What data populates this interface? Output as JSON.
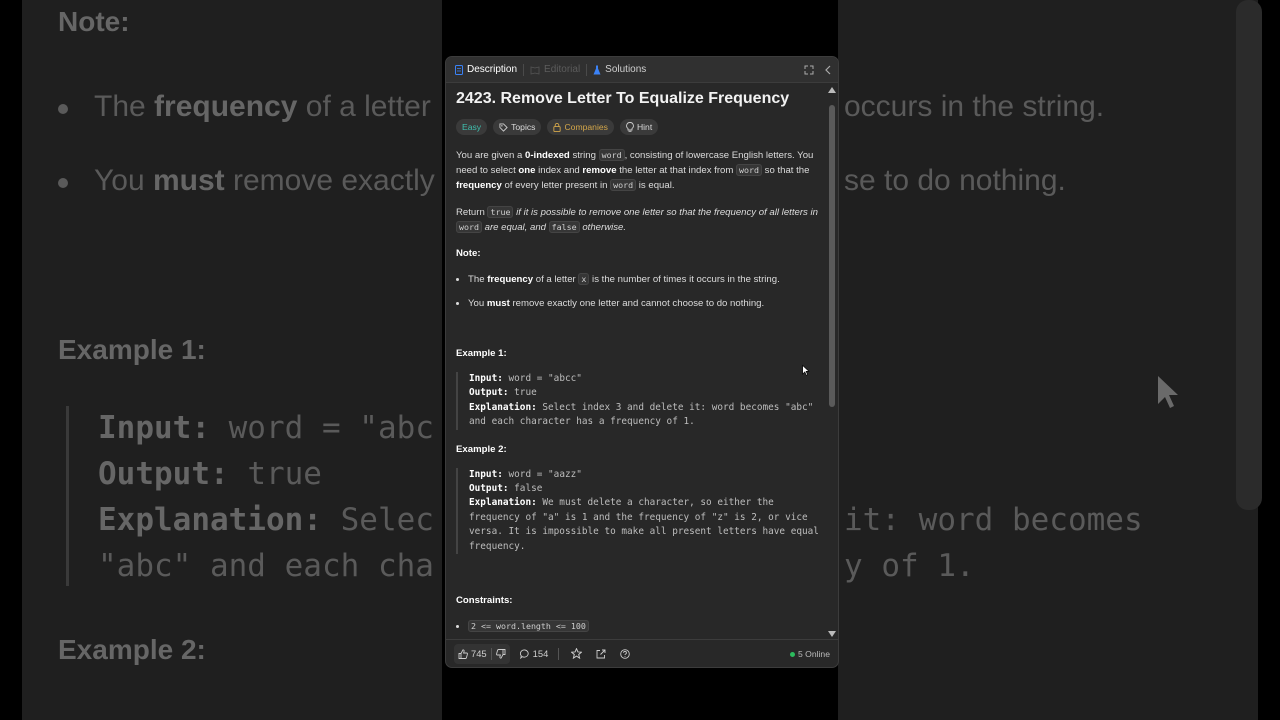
{
  "tabs": [
    {
      "label": "Description",
      "state": "active"
    },
    {
      "label": "Editorial",
      "state": "disabled"
    },
    {
      "label": "Solutions",
      "state": "normal"
    }
  ],
  "problem": {
    "title": "2423. Remove Letter To Equalize Frequency",
    "tags": [
      "Easy",
      "Topics",
      "Companies",
      "Hint"
    ],
    "para1": {
      "t1": "You are given a ",
      "b1": "0-indexed",
      "t2": " string ",
      "c1": "word",
      "t3": ", consisting of lowercase English letters. You need to select ",
      "b2": "one",
      "t4": " index and ",
      "b3": "remove",
      "t5": " the letter at that index from ",
      "c2": "word",
      "t6": " so that the ",
      "b4": "frequency",
      "t7": " of every letter present in ",
      "c3": "word",
      "t8": " is equal."
    },
    "para2": {
      "t1": "Return ",
      "c1": "true",
      "i1": " if it is possible to remove one letter so that the frequency of all letters in ",
      "c2": "word",
      "i2": " are equal, and ",
      "c3": "false",
      "i3": " otherwise."
    },
    "note_heading": "Note:",
    "note1": {
      "t1": "The ",
      "b1": "frequency",
      "t2": " of a letter ",
      "c1": "x",
      "t3": " is the number of times it occurs in the string."
    },
    "note2": {
      "t1": "You ",
      "b1": "must",
      "t2": " remove exactly one letter and cannot choose to do nothing."
    },
    "examples": [
      {
        "heading": "Example 1:",
        "input_label": "Input:",
        "input": " word = \"abcc\"",
        "output_label": "Output:",
        "output": " true",
        "explanation_label": "Explanation:",
        "explanation": " Select index 3 and delete it: word becomes \"abc\" and each character has a frequency of 1."
      },
      {
        "heading": "Example 2:",
        "input_label": "Input:",
        "input": " word = \"aazz\"",
        "output_label": "Output:",
        "output": " false",
        "explanation_label": "Explanation:",
        "explanation": " We must delete a character, so either the frequency of \"a\" is 1 and the frequency of \"z\" is 2, or vice versa. It is impossible to make all present letters have equal frequency."
      }
    ],
    "constraints_heading": "Constraints:",
    "constraint1": "2 <= word.length <= 100"
  },
  "footer": {
    "likes": "745",
    "comments": "154",
    "online": "5 Online"
  },
  "background": {
    "note": "Note:",
    "l1_a": "The ",
    "l1_b": "frequency",
    "l1_c": " of a letter",
    "l2_a": "You ",
    "l2_b": "must",
    "l2_c": " remove exactly",
    "ex1": "Example 1:",
    "in_label": "Input:",
    "in_val": " word = \"abc",
    "out_label": "Output:",
    "out_val": " true",
    "exp_label": "Explanation:",
    "exp_val": " Selec",
    "exp_line2": "\"abc\" and each cha",
    "ex2": "Example 2:",
    "r1": "occurs in the string.",
    "r2": "se to do nothing.",
    "r3": "it: word becomes",
    "r4": "y of 1."
  },
  "colors": {
    "easy": "#3fbfae",
    "companies": "#d4a74a",
    "online_dot": "#2cbb5d"
  }
}
